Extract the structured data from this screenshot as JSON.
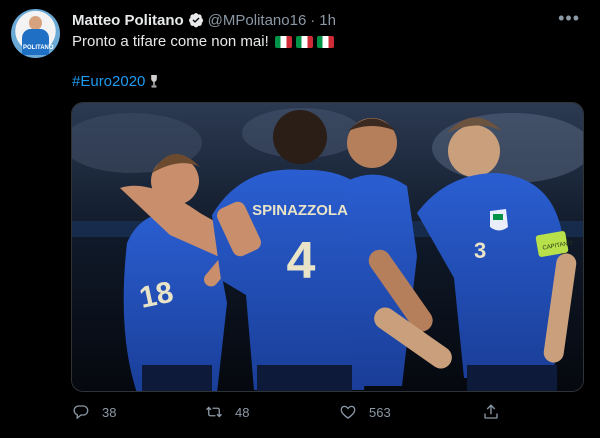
{
  "tweet": {
    "author_name": "Matteo Politano",
    "handle": "@MPolitano16",
    "separator": "·",
    "time": "1h",
    "avatar_caption": "POLITANO",
    "text": "Pronto a tifare come non mai!",
    "flags": [
      "italy-flag",
      "italy-flag",
      "italy-flag"
    ],
    "hashtag": "#Euro2020",
    "more_icon": "•••",
    "photo": {
      "jerseys": [
        {
          "name": "SPINAZZOLA",
          "number": "4"
        },
        {
          "name": "",
          "number": "3"
        },
        {
          "name": "",
          "number": "18"
        }
      ],
      "captain_band": "CAPITANO"
    },
    "counts": {
      "replies": "38",
      "retweets": "48",
      "likes": "563"
    }
  },
  "colors": {
    "background": "#000000",
    "text": "#e7e9ea",
    "muted": "#8b98a5",
    "link": "#1d9bf0",
    "jersey": "#1f4fb4"
  },
  "icons": [
    "verified-badge-icon",
    "more-icon",
    "trophy-icon",
    "reply-icon",
    "retweet-icon",
    "like-icon",
    "share-icon"
  ]
}
